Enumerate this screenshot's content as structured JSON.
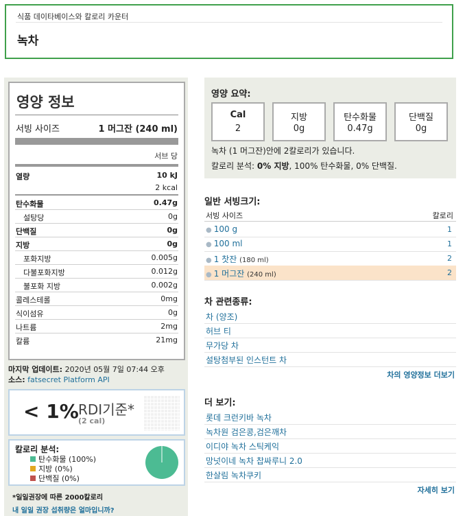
{
  "header": {
    "breadcrumb": "식품 데이타베이스와 칼로리 카운터",
    "title": "녹차"
  },
  "nutrition": {
    "title": "영양 정보",
    "serving_label": "서빙 사이즈",
    "serving_value": "1 머그잔 (240 ml)",
    "per_serving": "서브 당",
    "rows": [
      {
        "label": "열량",
        "value": "10 kJ"
      },
      {
        "label": "",
        "value": "2 kcal"
      },
      {
        "label": "탄수화물",
        "value": "0.47g"
      },
      {
        "label": "설탕당",
        "value": "0g"
      },
      {
        "label": "단백질",
        "value": "0g"
      },
      {
        "label": "지방",
        "value": "0g"
      },
      {
        "label": "포화지방",
        "value": "0.005g"
      },
      {
        "label": "다불포화지방",
        "value": "0.012g"
      },
      {
        "label": "불포화 지방",
        "value": "0.002g"
      },
      {
        "label": "콜레스테롤",
        "value": "0mg"
      },
      {
        "label": "식이섬유",
        "value": "0g"
      },
      {
        "label": "나트륨",
        "value": "2mg"
      },
      {
        "label": "칼륨",
        "value": "21mg"
      }
    ]
  },
  "meta": {
    "updated_label": "마지막 업데이트:",
    "updated_value": "2020년 05월 7일 07:44 오후",
    "source_label": "소스:",
    "source_value": "fatsecret Platform API"
  },
  "rdi": {
    "percent": "< 1%",
    "label": "RDI기준*",
    "cal": "(2 cal)"
  },
  "breakdown": {
    "title": "칼로리 분석:",
    "items": [
      {
        "label": "탄수화물 (100%)",
        "color": "#4cbb93",
        "percent": 100
      },
      {
        "label": "지방 (0%)",
        "color": "#e3a820",
        "percent": 0
      },
      {
        "label": "단백질 (0%)",
        "color": "#c0524d",
        "percent": 0
      }
    ]
  },
  "footnote": "*일일권장에 따른 2000칼로리",
  "footlink": "내 일일 권장 섭취량은 얼마입니까?",
  "summary": {
    "title": "영양 요약:",
    "cards": [
      {
        "label": "Cal",
        "value": "2"
      },
      {
        "label": "지방",
        "value": "0g"
      },
      {
        "label": "탄수화물",
        "value": "0.47g"
      },
      {
        "label": "단백질",
        "value": "0g"
      }
    ],
    "line1": "녹차 (1 머그잔)안에 2칼로리가 있습니다.",
    "line2_prefix": "칼로리 분석:",
    "line2_fat": "0% 지방",
    "line2_rest": ", 100% 탄수화물, 0% 단백질."
  },
  "servings": {
    "title": "일반 서빙크기:",
    "col_size": "서빙 사이즈",
    "col_cal": "칼로리",
    "rows": [
      {
        "size": "100 g",
        "note": "",
        "cal": "1"
      },
      {
        "size": "100 ml",
        "note": "",
        "cal": "1"
      },
      {
        "size": "1 찻잔",
        "note": "(180 ml)",
        "cal": "2"
      },
      {
        "size": "1 머그잔",
        "note": "(240 ml)",
        "cal": "2"
      }
    ]
  },
  "related": {
    "title": "차 관련종류:",
    "items": [
      "차 (양조)",
      "허브 티",
      "무가당 차",
      "설탕첨부된 인스턴트 차"
    ],
    "more": "차의 영양정보 더보기"
  },
  "see_more": {
    "title": "더 보기:",
    "items": [
      "롯데 크런키바 녹차",
      "녹차원 검은콩,검은깨차",
      "이디야 녹차 스틱케익",
      "망넛이네 녹차 찹싸루니 2.0",
      "한살림 녹차쿠키"
    ],
    "more": "자세히 보기"
  }
}
